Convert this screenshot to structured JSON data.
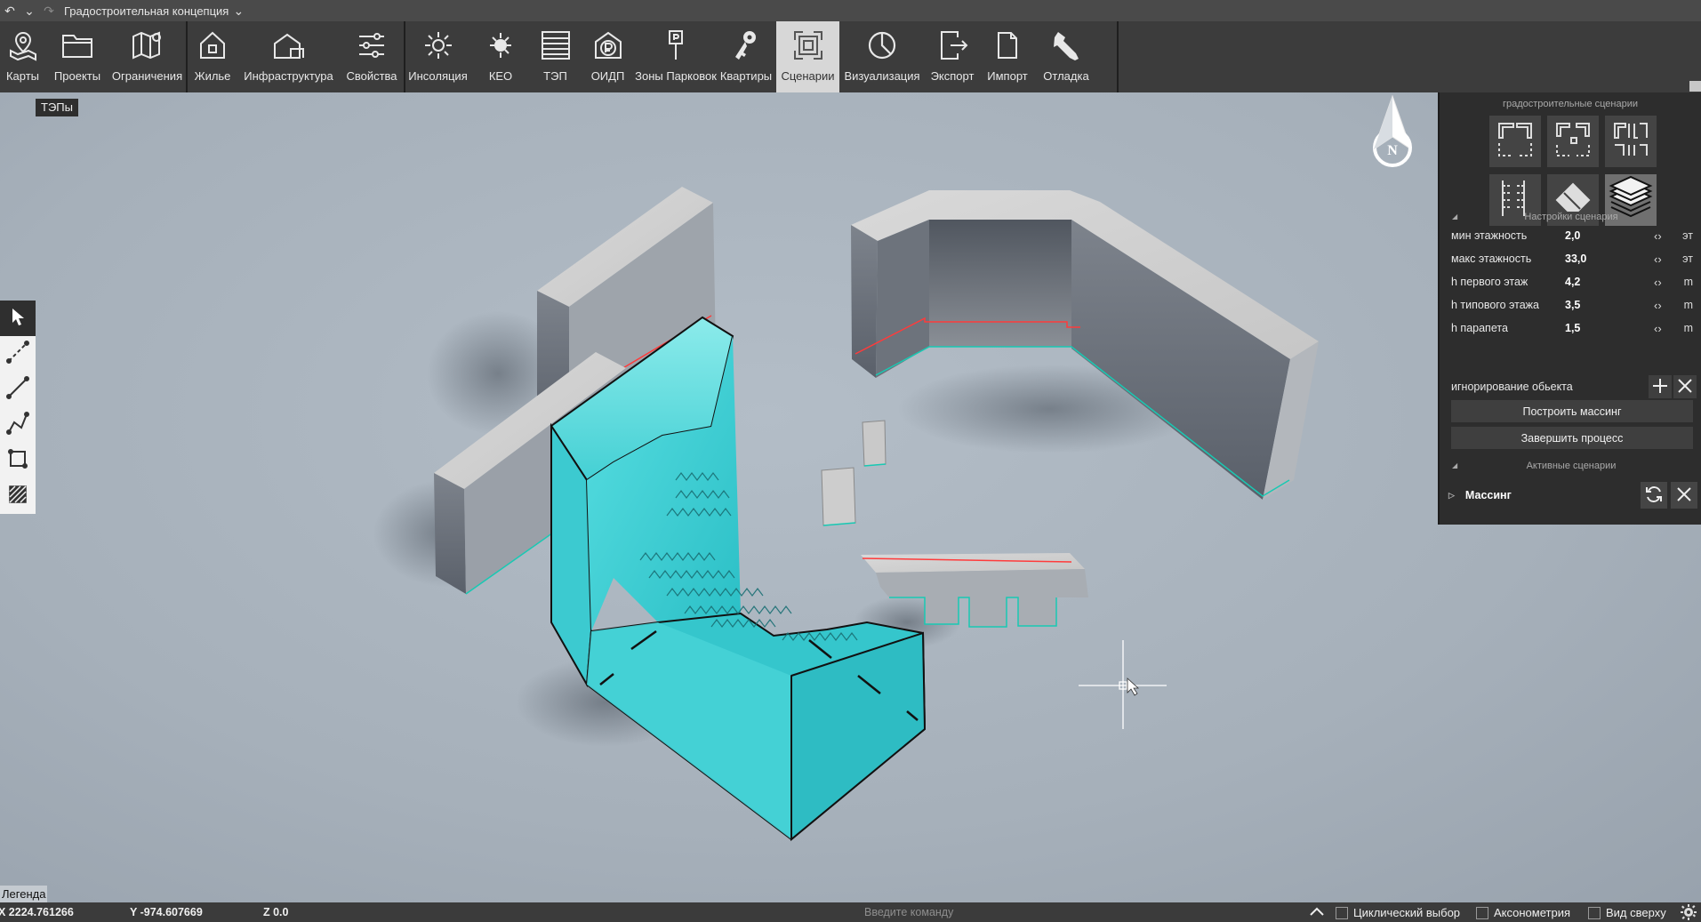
{
  "titlebar": {
    "title": "Градостроительная концепция",
    "icons": [
      "undo-icon",
      "dropdown-icon",
      "redo-icon",
      "chevron-down-icon"
    ]
  },
  "toolbar": {
    "items": [
      {
        "label": "Карты",
        "icon": "map-pin-icon"
      },
      {
        "label": "Проекты",
        "icon": "folder-icon"
      },
      {
        "label": "Ограничения",
        "icon": "map-restrictions-icon"
      },
      {
        "label": "Жилье",
        "icon": "house-icon"
      },
      {
        "label": "Инфраструктура",
        "icon": "infrastructure-icon"
      },
      {
        "label": "Свойства",
        "icon": "sliders-icon"
      },
      {
        "label": "Инсоляция",
        "icon": "sun-icon"
      },
      {
        "label": "КЕО",
        "icon": "light-icon"
      },
      {
        "label": "ТЭП",
        "icon": "table-icon"
      },
      {
        "label": "ОИДП",
        "icon": "ruble-house-icon"
      },
      {
        "label": "Зоны Парковок",
        "icon": "parking-sign-icon"
      },
      {
        "label": "Квартиры",
        "icon": "keys-icon"
      },
      {
        "label": "Сценарии",
        "icon": "scenario-icon",
        "active": true
      },
      {
        "label": "Визуализация",
        "icon": "pie-chart-icon"
      },
      {
        "label": "Экспорт",
        "icon": "export-icon"
      },
      {
        "label": "Импорт",
        "icon": "import-icon"
      },
      {
        "label": "Отладка",
        "icon": "wrench-icon"
      }
    ]
  },
  "viewport": {
    "tep_tag": "ТЭПы",
    "legend": "Легенда",
    "compass_letter": "N"
  },
  "right_panel": {
    "scenarios_title": "градостроительные сценарии",
    "settings_title": "Настройки сценария",
    "params": [
      {
        "name": "мин этажность",
        "value": "2,0",
        "unit": "эт"
      },
      {
        "name": "макс этажность",
        "value": "33,0",
        "unit": "эт"
      },
      {
        "name": "h первого этаж",
        "value": "4,2",
        "unit": "m"
      },
      {
        "name": "h типового этажа",
        "value": "3,5",
        "unit": "m"
      },
      {
        "name": "h парапета",
        "value": "1,5",
        "unit": "m"
      }
    ],
    "ignore_label": "игнорирование обьекта",
    "build_button": "Построить массинг",
    "finish_button": "Завершить процесс",
    "active_title": "Активные сценарии",
    "active_item": "Массинг"
  },
  "statusbar": {
    "x": "X 2224.761266",
    "y": "Y -974.607669",
    "z": "Z 0.0",
    "command_placeholder": "Введите команду",
    "cyclic": "Циклический выбор",
    "axonometry": "Аксонометрия",
    "top_view": "Вид сверху"
  },
  "colors": {
    "accent_cyan": "#3fd3d8",
    "toolbar_bg": "#3c3c3c",
    "panel_bg": "#2d2d2d",
    "viewport_bg": "#a9b3bd"
  }
}
